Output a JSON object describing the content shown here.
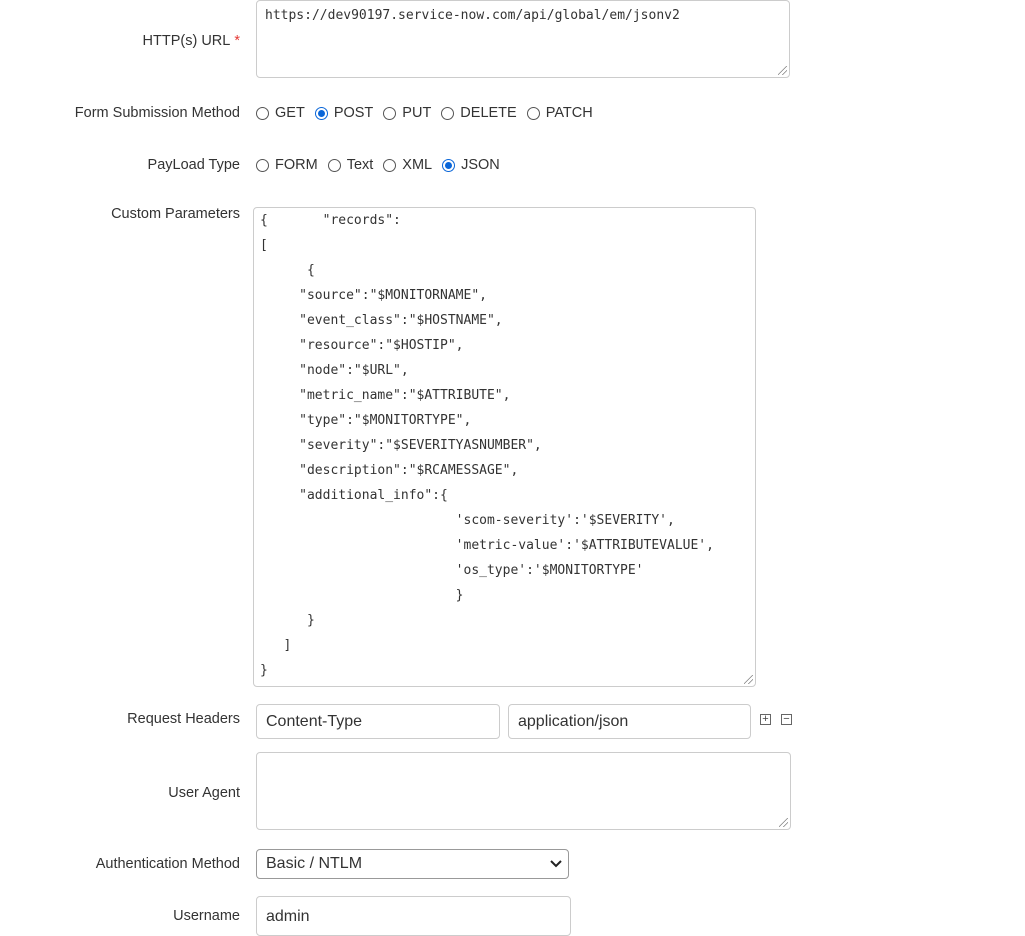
{
  "url": {
    "label": "HTTP(s) URL",
    "required": "*",
    "value": "https://dev90197.service-now.com/api/global/em/jsonv2"
  },
  "method": {
    "label": "Form Submission Method",
    "options": [
      "GET",
      "POST",
      "PUT",
      "DELETE",
      "PATCH"
    ],
    "selected": "POST"
  },
  "payload": {
    "label": "PayLoad Type",
    "options": [
      "FORM",
      "Text",
      "XML",
      "JSON"
    ],
    "selected": "JSON"
  },
  "custom": {
    "label": "Custom Parameters",
    "lines": [
      "{       \"records\":",
      "[",
      "      {",
      "     \"source\":\"$MONITORNAME\",",
      "     \"event_class\":\"$HOSTNAME\",",
      "     \"resource\":\"$HOSTIP\",",
      "     \"node\":\"$URL\",",
      "     \"metric_name\":\"$ATTRIBUTE\",",
      "     \"type\":\"$MONITORTYPE\",",
      "     \"severity\":\"$SEVERITYASNUMBER\",",
      "     \"description\":\"$RCAMESSAGE\",",
      "     \"additional_info\":{",
      "                         'scom-severity':'$SEVERITY',",
      "                         'metric-value':'$ATTRIBUTEVALUE',",
      "                         'os_type':'$MONITORTYPE'",
      "                         }",
      "      }",
      "   ]",
      "}"
    ]
  },
  "headers": {
    "label": "Request Headers",
    "name": "Content-Type",
    "value": "application/json"
  },
  "user_agent": {
    "label": "User Agent",
    "value": ""
  },
  "auth": {
    "label": "Authentication Method",
    "selected": "Basic / NTLM"
  },
  "username": {
    "label": "Username",
    "value": "admin"
  }
}
